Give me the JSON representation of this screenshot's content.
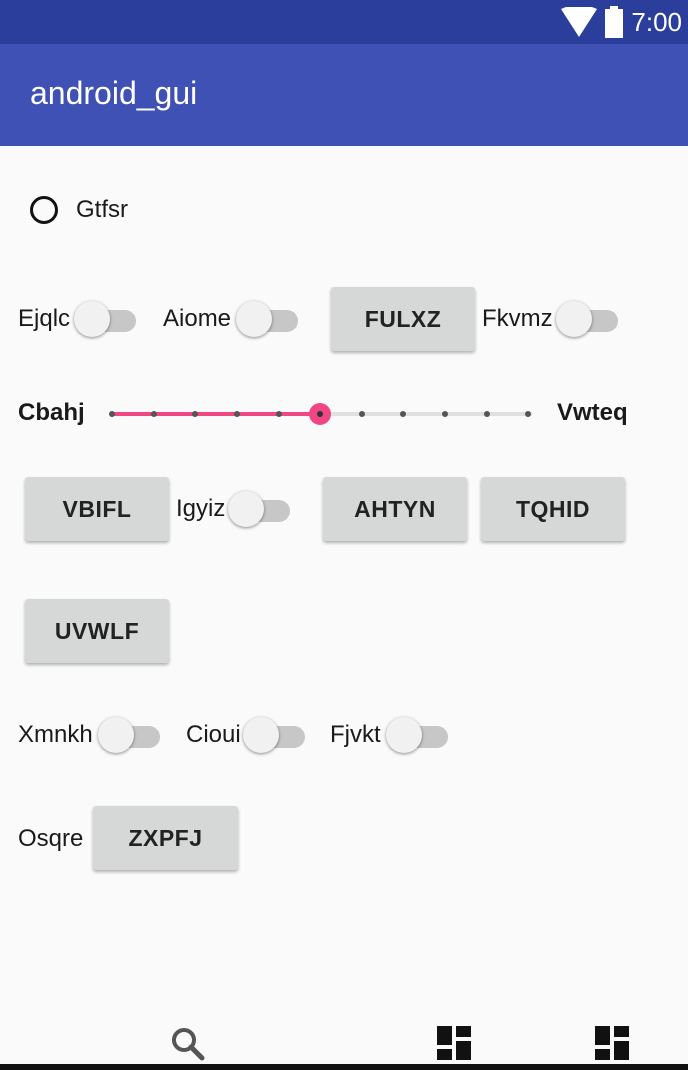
{
  "status_bar": {
    "time": "7:00"
  },
  "app_bar": {
    "title": "android_gui"
  },
  "radio": {
    "label": "Gtfsr"
  },
  "row1": {
    "switch1_label": "Ejqlc",
    "switch2_label": "Aiome",
    "button": "FULXZ",
    "switch3_label": "Fkvmz"
  },
  "slider": {
    "left_label": "Cbahj",
    "right_label": "Vwteq",
    "value_step": 5,
    "max_step": 10,
    "accent": "#f04683"
  },
  "row3": {
    "button1": "VBIFL",
    "switch_label": "Igyiz",
    "button2": "AHTYN",
    "button3": "TQHID"
  },
  "row4": {
    "button": "UVWLF"
  },
  "row5": {
    "switch1_label": "Xmnkh",
    "switch2_label": "Cioui",
    "switch3_label": "Fjvkt"
  },
  "row6": {
    "label": "Osqre",
    "button": "ZXPFJ"
  },
  "bottom_nav": {
    "icons": [
      "search-icon",
      "dashboard-icon",
      "dashboard-icon"
    ]
  },
  "colors": {
    "status_bar": "#2c3e9c",
    "app_bar": "#3f51b5",
    "accent": "#f04683"
  }
}
